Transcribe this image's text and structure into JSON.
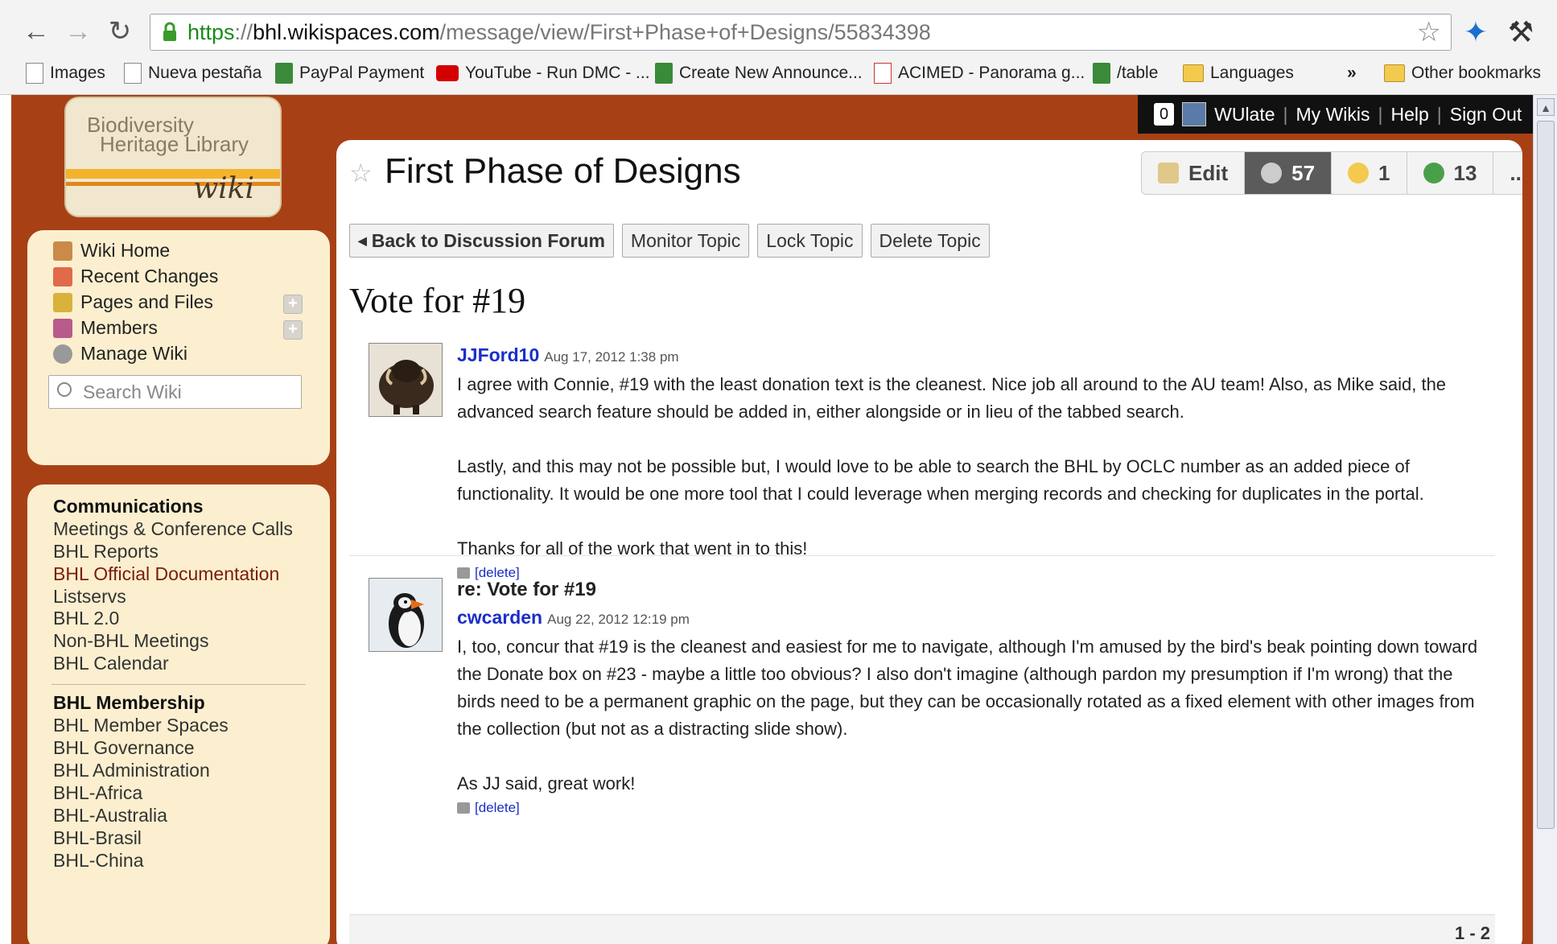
{
  "browser": {
    "url_scheme": "https",
    "url_sep": "://",
    "url_host": "bhl.wikispaces.com",
    "url_path": "/message/view/First+Phase+of+Designs/55834398",
    "bookmarks": [
      "Images",
      "Nueva pestaña",
      "PayPal Payment",
      "YouTube - Run DMC - ...",
      "Create New Announce...",
      "ACIMED - Panorama g...",
      "/table",
      "Languages",
      "»",
      "Other bookmarks"
    ]
  },
  "userbar": {
    "count": "0",
    "username": "WUlate",
    "my_wikis": "My Wikis",
    "help": "Help",
    "sign_out": "Sign Out",
    "sep": "|"
  },
  "logo": {
    "line1": "Biodiversity",
    "line2": "Heritage Library",
    "wiki": "wiki"
  },
  "sidebar": {
    "nav": [
      "Wiki Home",
      "Recent Changes",
      "Pages and Files",
      "Members",
      "Manage Wiki"
    ],
    "search_placeholder": "Search Wiki",
    "sections": [
      {
        "heading": "Communications",
        "items": [
          "Meetings & Conference Calls",
          "BHL Reports",
          "BHL Official Documentation",
          "Listservs",
          "BHL 2.0",
          "Non-BHL Meetings",
          "BHL Calendar"
        ]
      },
      {
        "heading": "BHL Membership",
        "items": [
          "BHL Member Spaces",
          "BHL Governance",
          "BHL Administration",
          "BHL-Africa",
          "BHL-Australia",
          "BHL-Brasil",
          "BHL-China"
        ]
      }
    ]
  },
  "main": {
    "page_title": "First Phase of Designs",
    "actions": {
      "edit": "Edit",
      "links_count": "57",
      "comments_count": "1",
      "history_count": "13",
      "more": "..."
    },
    "buttons": {
      "back": "Back to Discussion Forum",
      "monitor": "Monitor Topic",
      "lock": "Lock Topic",
      "delete": "Delete Topic"
    },
    "thread_title": "Vote for #19",
    "posts": [
      {
        "author": "JJFord10",
        "date": "Aug 17, 2012 1:38 pm",
        "paragraphs": [
          "I agree with Connie, #19 with the least donation text is the cleanest. Nice job all around to the AU team! Also, as Mike said, the advanced search feature should be added in, either alongside or in lieu of the tabbed search.",
          "Lastly, and this may not be possible but, I would love to be able to search the BHL by OCLC number as an added piece of functionality. It would be one more tool that I could leverage when merging records and checking for duplicates in the portal.",
          "Thanks for all of the work that went in to this!"
        ],
        "delete_label": "[delete]"
      },
      {
        "reply_title": "re: Vote for #19",
        "author": "cwcarden",
        "date": "Aug 22, 2012 12:19 pm",
        "paragraphs": [
          "I, too, concur that #19 is the cleanest and easiest for me to navigate, although I'm amused by the bird's beak pointing down toward the Donate box on #23 - maybe a little too obvious? I also don't imagine (although pardon my presumption if I'm wrong) that the birds need to be a permanent graphic on the page, but they can be occasionally rotated as a fixed element with other images from the collection (but not as a distracting slide show).",
          "As JJ said, great work!"
        ],
        "delete_label": "[delete]"
      }
    ],
    "pager": "1 - 2"
  },
  "colors": {
    "page_bg": "#a74115",
    "sidebar_bg": "#fbefcf",
    "link": "#1a2fc7"
  }
}
